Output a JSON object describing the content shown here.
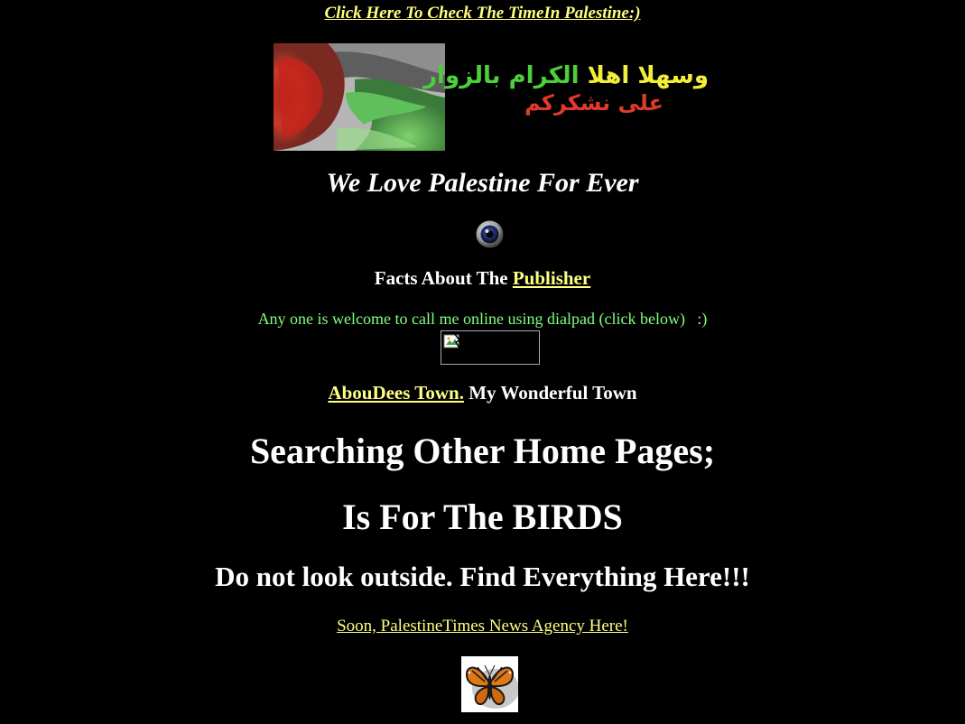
{
  "header": {
    "time_link": "Click Here To Check The TimeIn Palestine:)"
  },
  "welcome": {
    "arabic_line1_green": "الكرام بالزوار",
    "arabic_line1_yellow": "وسهلا اهلا",
    "arabic_line2_red": "على نشكركم"
  },
  "tagline": "We Love Palestine For Ever",
  "facts": {
    "prefix": "Facts About The",
    "link": "Publisher"
  },
  "dialpad": {
    "text": "Any one is welcome to call me online using dialpad (click below)   :)"
  },
  "town": {
    "link": "AbouDees Town.",
    "suffix": " My Wonderful Town"
  },
  "headlines": {
    "searching": "Searching Other Home Pages;",
    "birds": "Is For The BIRDS",
    "outside": "Do not look outside. Find Everything Here!!!"
  },
  "news": {
    "link": "Soon, PalestineTimes News Agency Here!"
  },
  "icons": {
    "eye": "eye-icon",
    "butterfly": "butterfly-icon",
    "flag": "flag-icon",
    "broken_image": "broken-image-icon"
  },
  "colors": {
    "background": "#000000",
    "link": "#ffff80",
    "text": "#ffffff",
    "green_text": "#80ff80",
    "arabic_green": "#4ccf3a",
    "arabic_yellow": "#f2ee3a",
    "arabic_red": "#e23a2a"
  }
}
